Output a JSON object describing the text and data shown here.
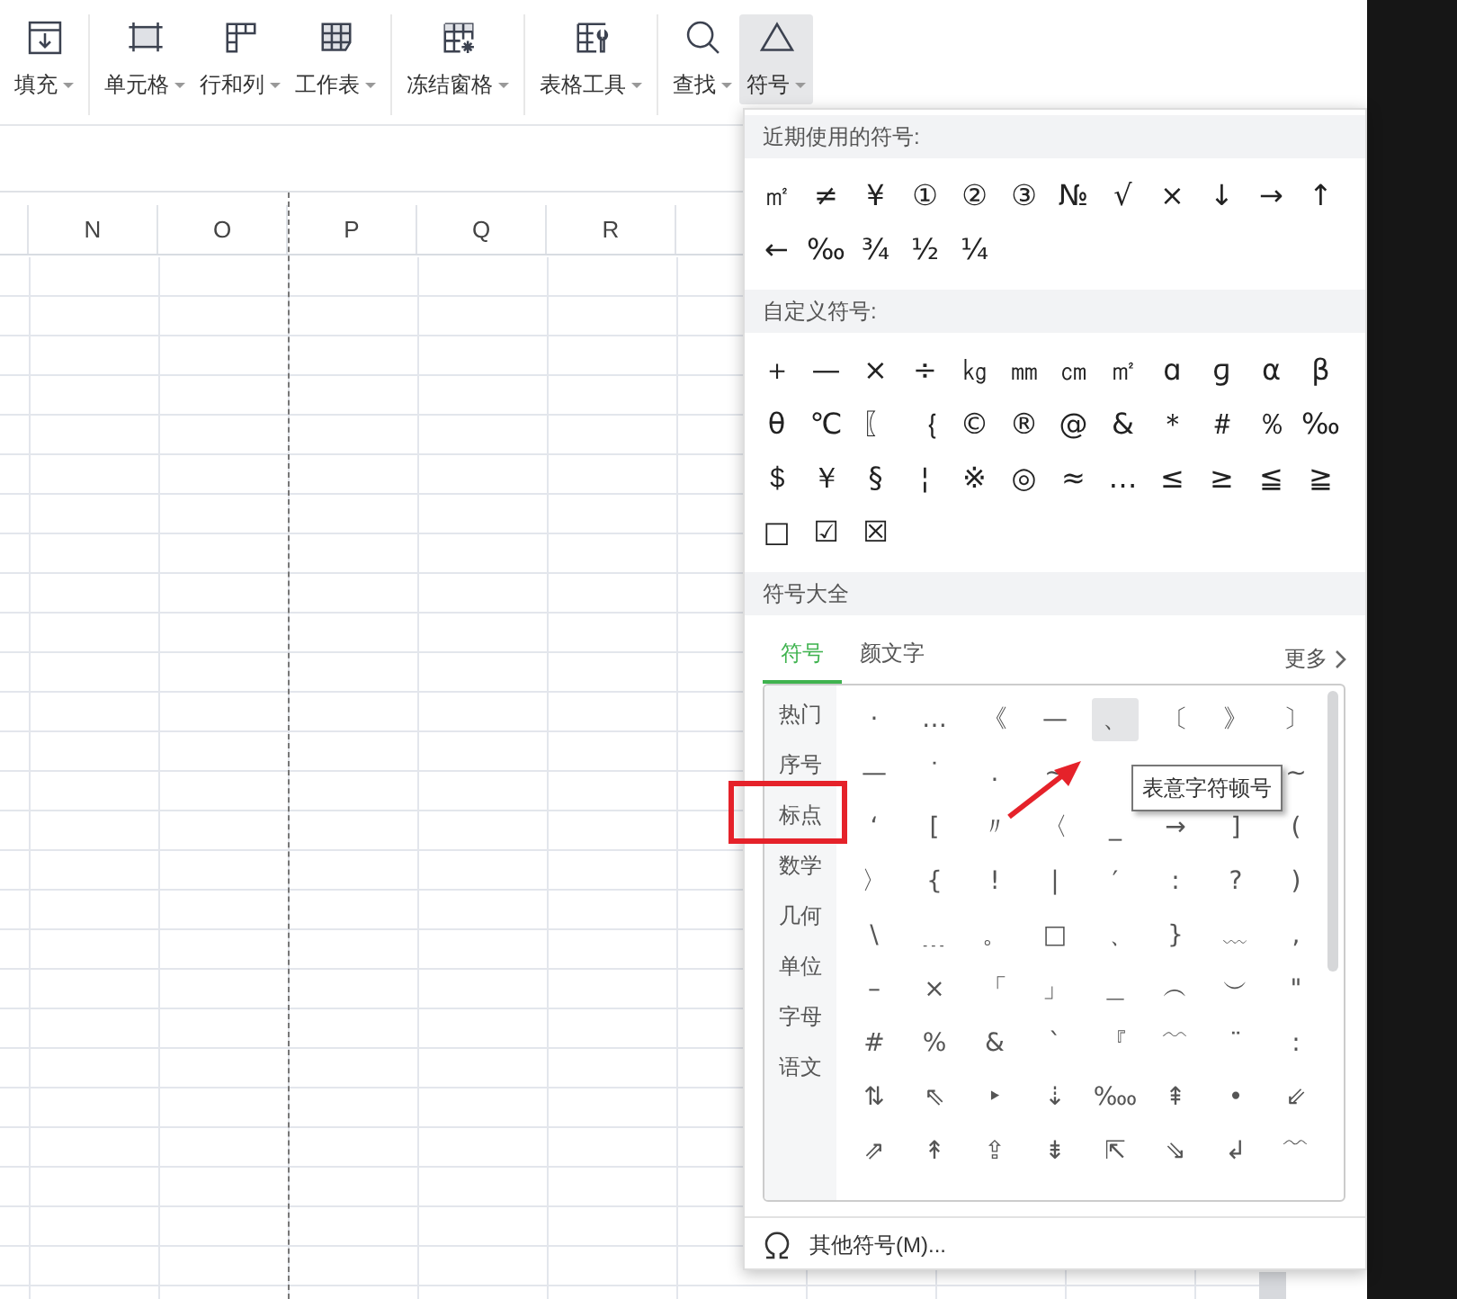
{
  "toolbar": [
    [
      {
        "label": "填充",
        "selected": false
      }
    ],
    [
      {
        "label": "单元格",
        "selected": false
      },
      {
        "label": "行和列",
        "selected": false
      },
      {
        "label": "工作表",
        "selected": false
      }
    ],
    [
      {
        "label": "冻结窗格",
        "selected": false
      }
    ],
    [
      {
        "label": "表格工具",
        "selected": false
      }
    ],
    [
      {
        "label": "查找",
        "selected": false
      },
      {
        "label": "符号",
        "selected": true
      }
    ]
  ],
  "columns": [
    "N",
    "O",
    "P",
    "Q",
    "R"
  ],
  "symbol_panel": {
    "recent": {
      "title": "近期使用的符号:",
      "symbols": [
        "㎡",
        "≠",
        "¥",
        "①",
        "②",
        "③",
        "№",
        "√",
        "×",
        "↓",
        "→",
        "↑",
        "←",
        "‰",
        "¾",
        "½",
        "¼"
      ]
    },
    "custom": {
      "title": "自定义符号:",
      "symbols": [
        "＋",
        "—",
        "×",
        "÷",
        "㎏",
        "㎜",
        "㎝",
        "㎡",
        "ɑ",
        "ɡ",
        "α",
        "β",
        "θ",
        "℃",
        "〖",
        "｛",
        "©",
        "®",
        "@",
        "&",
        "＊",
        "＃",
        "％",
        "‰",
        "＄",
        "￥",
        "§",
        "¦",
        "※",
        "◎",
        "≈",
        "…",
        "≤",
        "≥",
        "≦",
        "≧",
        "□",
        "☑",
        "☒"
      ]
    },
    "all_title": "符号大全",
    "tabs": [
      {
        "label": "符号",
        "selected": true
      },
      {
        "label": "颜文字",
        "selected": false
      }
    ],
    "more": "更多",
    "categories": [
      "热门",
      "序号",
      "标点",
      "数学",
      "几何",
      "单位",
      "字母",
      "语文"
    ],
    "grid": [
      {
        "cells": [
          {
            "c": "·",
            "hovered": false
          },
          {
            "c": "…",
            "hovered": false
          },
          {
            "c": "《",
            "hovered": false
          },
          {
            "c": "—",
            "hovered": false
          },
          {
            "c": "、",
            "hovered": true
          },
          {
            "c": "〔",
            "hovered": false
          },
          {
            "c": "》",
            "hovered": false
          },
          {
            "c": "〕",
            "hovered": false
          }
        ]
      },
      {
        "cells": [
          {
            "c": "—",
            "hovered": false
          },
          {
            "c": "˙",
            "hovered": false
          },
          {
            "c": ".",
            "hovered": false
          },
          {
            "c": "~",
            "hovered": false
          }
        ],
        "end_cells": [
          {
            "c": "~",
            "hovered": false
          }
        ]
      },
      {
        "cells": [
          {
            "c": "‘",
            "hovered": false
          },
          {
            "c": "[",
            "hovered": false
          },
          {
            "c": "〃",
            "hovered": false
          },
          {
            "c": "〈",
            "hovered": false
          },
          {
            "c": "_",
            "hovered": false
          },
          {
            "c": "→",
            "hovered": false
          },
          {
            "c": "]",
            "hovered": false
          },
          {
            "c": "(",
            "hovered": false
          }
        ]
      },
      {
        "cells": [
          {
            "c": "〉",
            "hovered": false
          },
          {
            "c": "{",
            "hovered": false
          },
          {
            "c": "!",
            "hovered": false
          },
          {
            "c": "|",
            "hovered": false
          },
          {
            "c": "′",
            "hovered": false
          },
          {
            "c": ":",
            "hovered": false
          },
          {
            "c": "?",
            "hovered": false
          },
          {
            "c": ")",
            "hovered": false
          }
        ]
      },
      {
        "cells": [
          {
            "c": "\\",
            "hovered": false
          },
          {
            "c": "﹍",
            "hovered": false
          },
          {
            "c": "。",
            "hovered": false
          },
          {
            "c": "□",
            "hovered": false
          },
          {
            "c": "﹑",
            "hovered": false
          },
          {
            "c": "}",
            "hovered": false
          },
          {
            "c": "﹏",
            "hovered": false
          },
          {
            "c": ",",
            "hovered": false
          }
        ]
      },
      {
        "cells": [
          {
            "c": "–",
            "hovered": false
          },
          {
            "c": "×",
            "hovered": false
          },
          {
            "c": "「",
            "hovered": false
          },
          {
            "c": "」",
            "hovered": false
          },
          {
            "c": "＿",
            "hovered": false
          },
          {
            "c": "︵",
            "hovered": false
          },
          {
            "c": "︶",
            "hovered": false
          },
          {
            "c": "\"",
            "hovered": false
          }
        ]
      },
      {
        "cells": [
          {
            "c": "#",
            "hovered": false
          },
          {
            "c": "%",
            "hovered": false
          },
          {
            "c": "&",
            "hovered": false
          },
          {
            "c": "`",
            "hovered": false
          },
          {
            "c": "『",
            "hovered": false
          },
          {
            "c": "﹋",
            "hovered": false
          },
          {
            "c": "¨",
            "hovered": false
          },
          {
            "c": ":",
            "hovered": false
          }
        ]
      },
      {
        "cells": [
          {
            "c": "⇅",
            "hovered": false
          },
          {
            "c": "⇖",
            "hovered": false
          },
          {
            "c": "‣",
            "hovered": false
          },
          {
            "c": "⇣",
            "hovered": false
          },
          {
            "c": "‱",
            "hovered": false
          },
          {
            "c": "⇞",
            "hovered": false
          },
          {
            "c": "•",
            "hovered": false
          },
          {
            "c": "⇙",
            "hovered": false
          }
        ]
      },
      {
        "cells": [
          {
            "c": "⇗",
            "hovered": false
          },
          {
            "c": "↟",
            "hovered": false
          },
          {
            "c": "⇪",
            "hovered": false
          },
          {
            "c": "⇟",
            "hovered": false
          },
          {
            "c": "⇱",
            "hovered": false
          },
          {
            "c": "⇘",
            "hovered": false
          },
          {
            "c": "↲",
            "hovered": false
          },
          {
            "c": "﹌",
            "hovered": false
          }
        ]
      }
    ],
    "tooltip": "表意字符顿号",
    "footer": "其他符号(M)..."
  }
}
